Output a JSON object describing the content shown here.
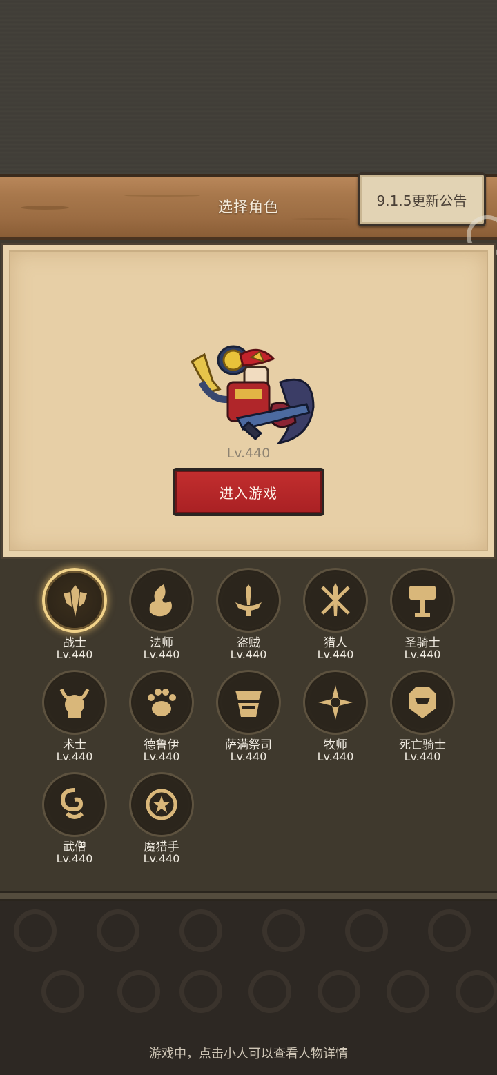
{
  "header": {
    "title": "选择角色",
    "notice_button": "9.1.5更新公告"
  },
  "hero": {
    "level": "Lv.440",
    "enter_button": "进入游戏"
  },
  "classes": [
    {
      "name": "战士",
      "level": "Lv.440",
      "icon": "sword-shield-icon",
      "selected": true
    },
    {
      "name": "法师",
      "level": "Lv.440",
      "icon": "flame-swirl-icon",
      "selected": false
    },
    {
      "name": "盗贼",
      "level": "Lv.440",
      "icon": "dagger-icon",
      "selected": false
    },
    {
      "name": "猎人",
      "level": "Lv.440",
      "icon": "crossed-arrows-icon",
      "selected": false
    },
    {
      "name": "圣骑士",
      "level": "Lv.440",
      "icon": "hammer-icon",
      "selected": false
    },
    {
      "name": "术士",
      "level": "Lv.440",
      "icon": "horned-skull-icon",
      "selected": false
    },
    {
      "name": "德鲁伊",
      "level": "Lv.440",
      "icon": "paw-icon",
      "selected": false
    },
    {
      "name": "萨满祭司",
      "level": "Lv.440",
      "icon": "totem-icon",
      "selected": false
    },
    {
      "name": "牧师",
      "level": "Lv.440",
      "icon": "radiant-star-icon",
      "selected": false
    },
    {
      "name": "死亡骑士",
      "level": "Lv.440",
      "icon": "helm-icon",
      "selected": false
    },
    {
      "name": "武僧",
      "level": "Lv.440",
      "icon": "cloud-swirl-icon",
      "selected": false
    },
    {
      "name": "魔猎手",
      "level": "Lv.440",
      "icon": "star-emblem-icon",
      "selected": false
    }
  ],
  "footer": {
    "hint": "游戏中，点击小人可以查看人物详情"
  },
  "colors": {
    "gold_icon": "#d9b77a",
    "enter_red": "#c22e2e",
    "parchment": "#e7cfa6"
  }
}
